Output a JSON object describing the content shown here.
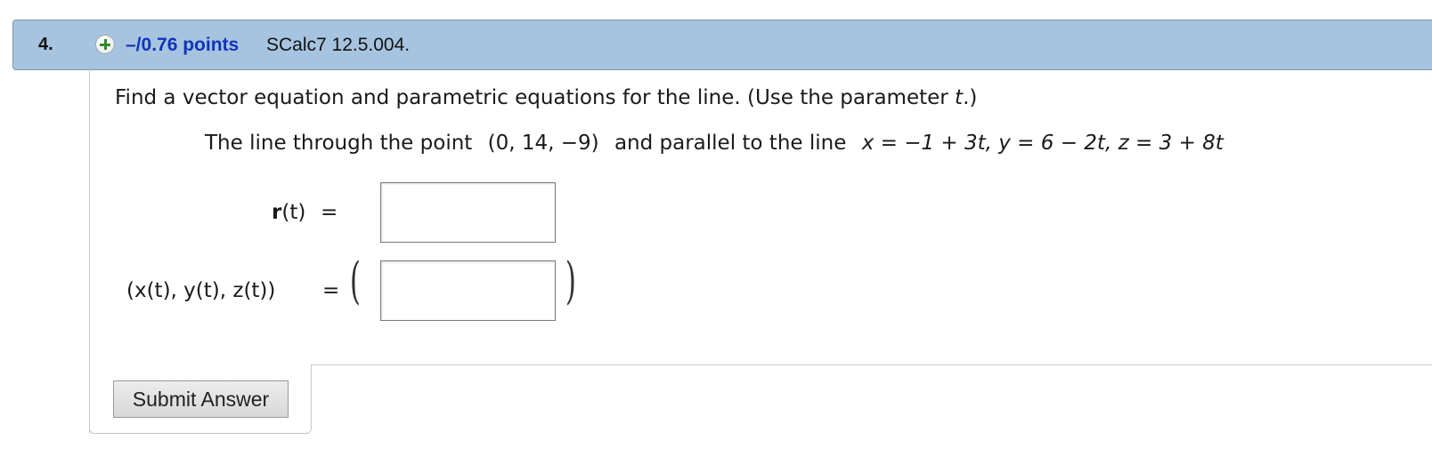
{
  "header": {
    "question_number": "4.",
    "points": "–/0.76 points",
    "source": "SCalc7 12.5.004."
  },
  "question": {
    "instruction_prefix": "Find a vector equation and parametric equations for the line. (Use the parameter ",
    "instruction_param": "t",
    "instruction_suffix": ".)",
    "problem_prefix": "The line through the point",
    "point": "(0, 14, −9)",
    "problem_middle": "and parallel to the line",
    "line_eq": "x = −1 + 3t, y = 6 − 2t, z = 3 + 8t"
  },
  "answers": {
    "vector_label_bold": "r",
    "vector_label_rest": "(t)",
    "equals": "=",
    "parametric_label": "(x(t), y(t), z(t))",
    "vector_value": "",
    "parametric_value": ""
  },
  "buttons": {
    "submit": "Submit Answer"
  },
  "icons": {
    "add": "plus-circle-icon"
  }
}
